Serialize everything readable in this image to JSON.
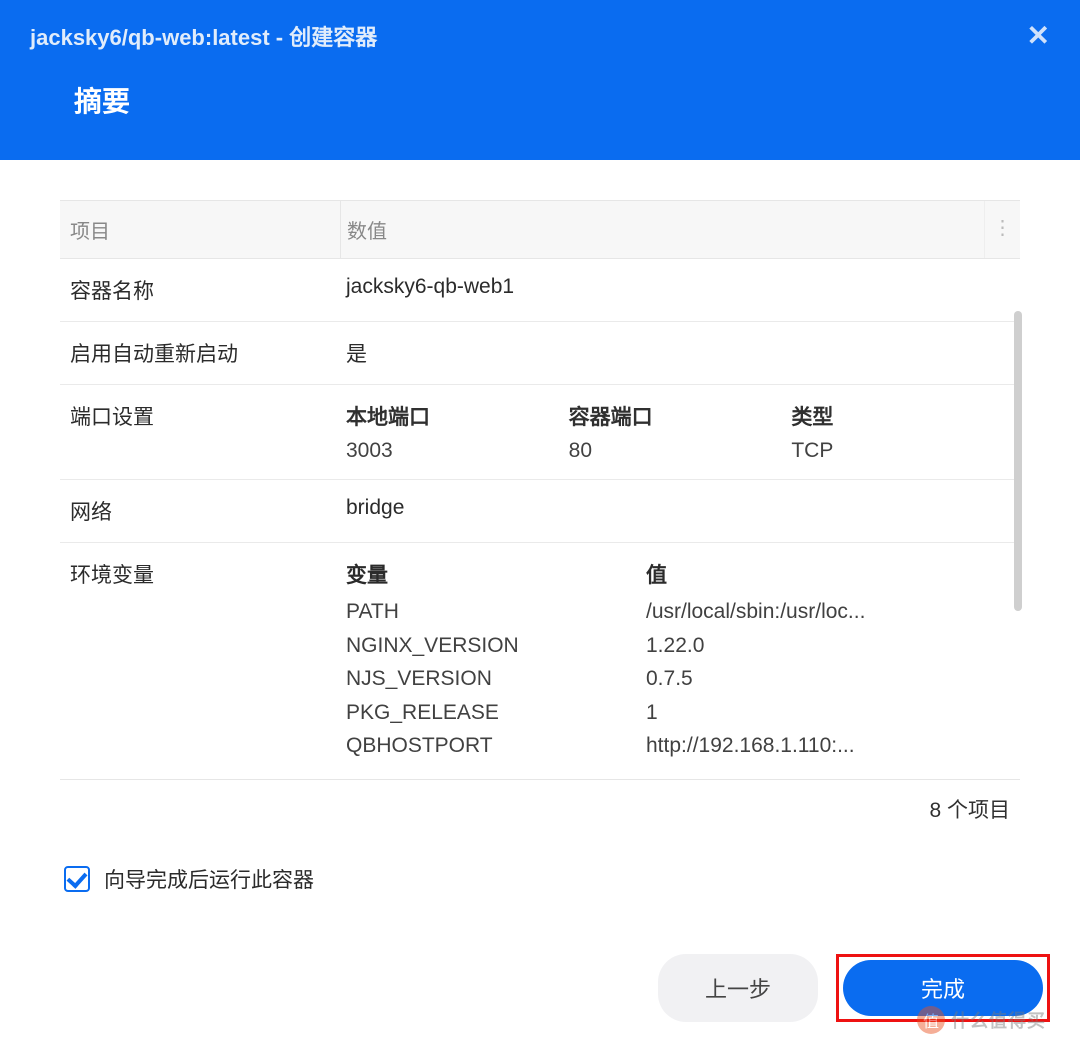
{
  "header": {
    "title": "jacksky6/qb-web:latest - 创建容器",
    "subtitle": "摘要"
  },
  "table": {
    "header_item": "项目",
    "header_value": "数值",
    "rows": {
      "container_name": {
        "label": "容器名称",
        "value": "jacksky6-qb-web1"
      },
      "auto_restart": {
        "label": "启用自动重新启动",
        "value": "是"
      },
      "port": {
        "label": "端口设置",
        "h_local": "本地端口",
        "h_container": "容器端口",
        "h_type": "类型",
        "local": "3003",
        "container": "80",
        "type": "TCP"
      },
      "network": {
        "label": "网络",
        "value": "bridge"
      },
      "env": {
        "label": "环境变量",
        "h_var": "变量",
        "h_val": "值",
        "items": [
          {
            "k": "PATH",
            "v": "/usr/local/sbin:/usr/loc..."
          },
          {
            "k": "NGINX_VERSION",
            "v": "1.22.0"
          },
          {
            "k": "NJS_VERSION",
            "v": "0.7.5"
          },
          {
            "k": "PKG_RELEASE",
            "v": "1"
          },
          {
            "k": "QBHOSTPORT",
            "v": "http://192.168.1.110:..."
          }
        ]
      }
    },
    "count": "8 个项目"
  },
  "run_after": {
    "label": "向导完成后运行此容器",
    "checked": true
  },
  "footer": {
    "prev": "上一步",
    "finish": "完成"
  },
  "watermark": {
    "badge": "值",
    "text": "什么值得买"
  }
}
